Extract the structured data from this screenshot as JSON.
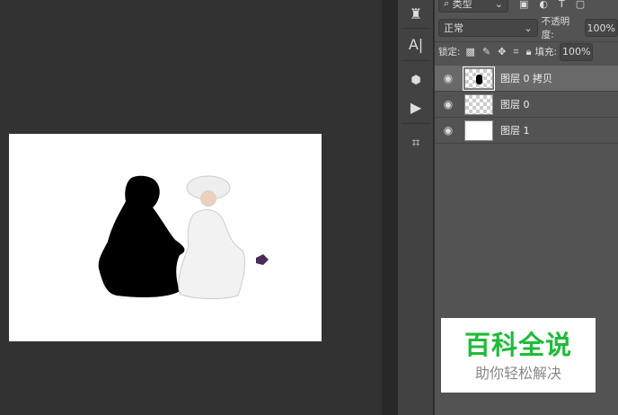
{
  "layers_panel": {
    "filter_kind": "类型",
    "blend_mode": "正常",
    "opacity_label": "不透明度:",
    "opacity_value": "100%",
    "lock_label": "锁定:",
    "fill_label": "填充:",
    "fill_value": "100%",
    "layers": [
      {
        "name": "图层 0 拷贝",
        "selected": true,
        "visible": true
      },
      {
        "name": "图层 0",
        "selected": false,
        "visible": true
      },
      {
        "name": "图层 1",
        "selected": false,
        "visible": true
      }
    ]
  },
  "toolbar": {
    "type_tool_label": "A|"
  },
  "watermark": {
    "title": "百科全说",
    "subtitle": "助你轻松解决"
  },
  "colors": {
    "accent": "#1fbb3a",
    "panel": "#535353",
    "canvas_bg": "#323232"
  }
}
